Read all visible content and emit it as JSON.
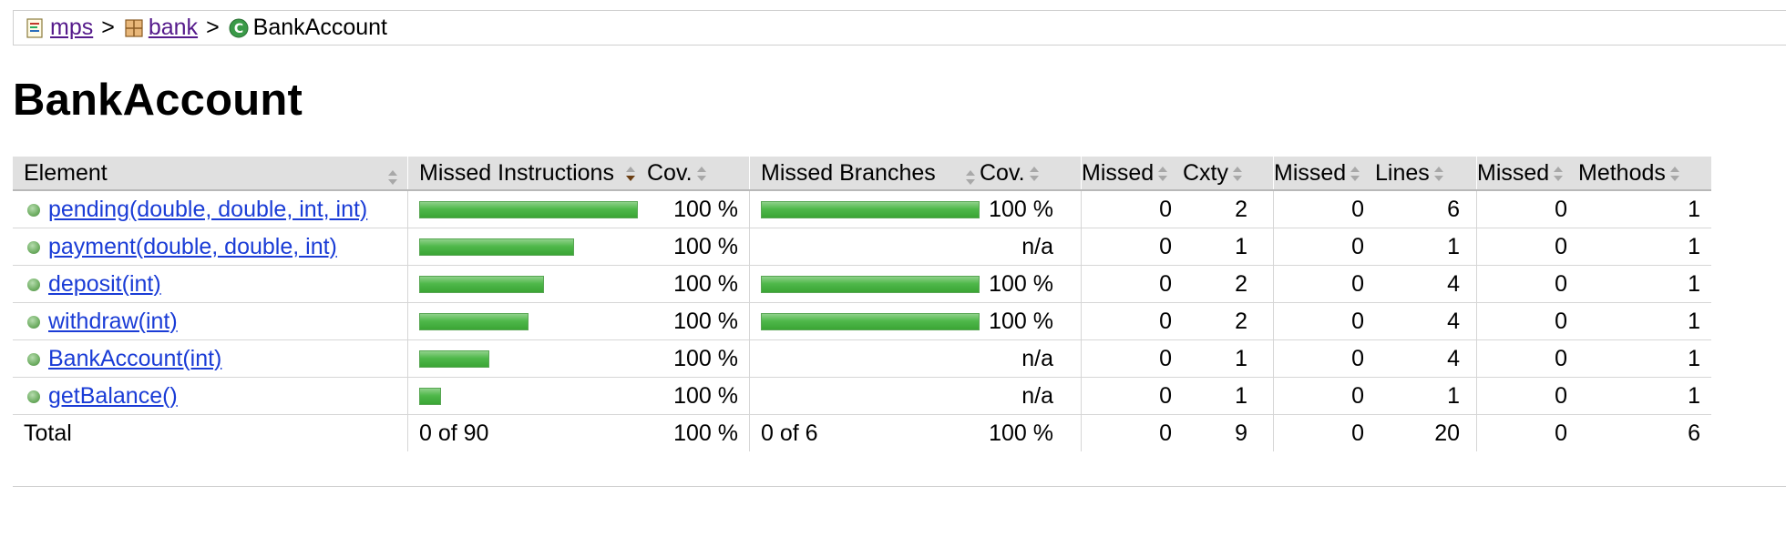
{
  "breadcrumb": {
    "items": [
      {
        "label": "mps",
        "icon": "report-icon"
      },
      {
        "label": "bank",
        "icon": "package-icon"
      },
      {
        "label": "BankAccount",
        "icon": "class-icon"
      }
    ],
    "separator": ">"
  },
  "page_title": "BankAccount",
  "table": {
    "headers": {
      "element": "Element",
      "missed_instructions": "Missed Instructions",
      "cov_instructions": "Cov.",
      "missed_branches": "Missed Branches",
      "cov_branches": "Cov.",
      "missed_cxty": "Missed",
      "cxty": "Cxty",
      "missed_lines": "Missed",
      "lines": "Lines",
      "missed_methods": "Missed",
      "methods": "Methods"
    },
    "rows": [
      {
        "name": "pending(double, double, int, int)",
        "instr_covered_fraction": 1.0,
        "instr_bar_fraction": 1.0,
        "instr_cov": "100 %",
        "branch_bar_fraction": 1.0,
        "branch_cov": "100 %",
        "missed_cxty": "0",
        "cxty": "2",
        "missed_lines": "0",
        "lines": "6",
        "missed_methods": "0",
        "methods": "1"
      },
      {
        "name": "payment(double, double, int)",
        "instr_covered_fraction": 1.0,
        "instr_bar_fraction": 0.71,
        "instr_cov": "100 %",
        "branch_bar_fraction": 0,
        "branch_cov": "n/a",
        "missed_cxty": "0",
        "cxty": "1",
        "missed_lines": "0",
        "lines": "1",
        "missed_methods": "0",
        "methods": "1"
      },
      {
        "name": "deposit(int)",
        "instr_covered_fraction": 1.0,
        "instr_bar_fraction": 0.57,
        "instr_cov": "100 %",
        "branch_bar_fraction": 1.0,
        "branch_cov": "100 %",
        "missed_cxty": "0",
        "cxty": "2",
        "missed_lines": "0",
        "lines": "4",
        "missed_methods": "0",
        "methods": "1"
      },
      {
        "name": "withdraw(int)",
        "instr_covered_fraction": 1.0,
        "instr_bar_fraction": 0.5,
        "instr_cov": "100 %",
        "branch_bar_fraction": 1.0,
        "branch_cov": "100 %",
        "missed_cxty": "0",
        "cxty": "2",
        "missed_lines": "0",
        "lines": "4",
        "missed_methods": "0",
        "methods": "1"
      },
      {
        "name": "BankAccount(int)",
        "instr_covered_fraction": 1.0,
        "instr_bar_fraction": 0.32,
        "instr_cov": "100 %",
        "branch_bar_fraction": 0,
        "branch_cov": "n/a",
        "missed_cxty": "0",
        "cxty": "1",
        "missed_lines": "0",
        "lines": "4",
        "missed_methods": "0",
        "methods": "1"
      },
      {
        "name": "getBalance()",
        "instr_covered_fraction": 1.0,
        "instr_bar_fraction": 0.1,
        "instr_cov": "100 %",
        "branch_bar_fraction": 0,
        "branch_cov": "n/a",
        "missed_cxty": "0",
        "cxty": "1",
        "missed_lines": "0",
        "lines": "1",
        "missed_methods": "0",
        "methods": "1"
      }
    ],
    "total": {
      "label": "Total",
      "instr": "0 of 90",
      "instr_cov": "100 %",
      "branch": "0 of 6",
      "branch_cov": "100 %",
      "missed_cxty": "0",
      "cxty": "9",
      "missed_lines": "0",
      "lines": "20",
      "missed_methods": "0",
      "methods": "6"
    }
  },
  "colors": {
    "bar_green": "#4fb84a",
    "link_blue": "#1a3cd6",
    "link_visited": "#551a8b",
    "header_bg": "#e0e0e0"
  }
}
